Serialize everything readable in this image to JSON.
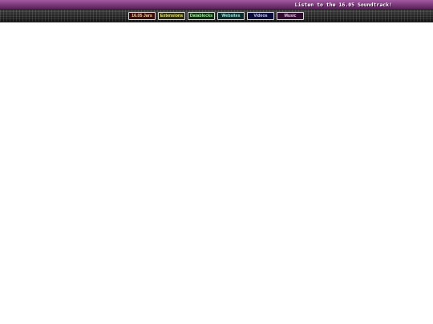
{
  "header": {
    "soundtrack_link": "Listen to the 16.05 Soundtrack!",
    "bar_color": "#7b3a7b"
  },
  "nav": {
    "items": [
      {
        "label": "16.05 Jars",
        "bg": "#3a0d0d",
        "fg": "#ffd9a0"
      },
      {
        "label": "Extensions",
        "bg": "#2a2a0c",
        "fg": "#f4f07a"
      },
      {
        "label": "Datablocks",
        "bg": "#0f2c0f",
        "fg": "#a8f0a8"
      },
      {
        "label": "Websites",
        "bg": "#0d2a2a",
        "fg": "#a9ecec"
      },
      {
        "label": "Videos",
        "bg": "#0c0c3a",
        "fg": "#d6d6ff"
      },
      {
        "label": "Music",
        "bg": "#2e0d2e",
        "fg": "#f6c8f6"
      }
    ]
  }
}
